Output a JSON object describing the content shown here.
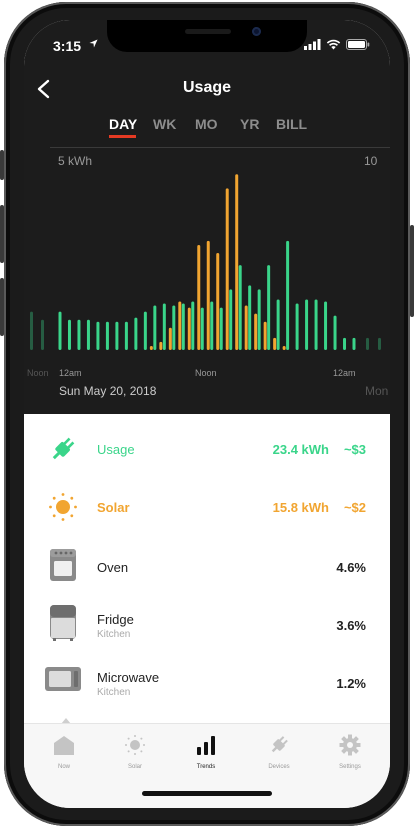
{
  "status": {
    "time": "3:15"
  },
  "header": {
    "title": "Usage"
  },
  "tabs": [
    {
      "label": "DAY",
      "active": true
    },
    {
      "label": "WK",
      "active": false
    },
    {
      "label": "MO",
      "active": false
    },
    {
      "label": "YR",
      "active": false
    },
    {
      "label": "BILL",
      "active": false
    }
  ],
  "chart_data": {
    "type": "bar",
    "y_label_left": "5 kWh",
    "y_label_right": "10",
    "x_ticks": [
      "12am",
      "Noon",
      "12am"
    ],
    "edge_ticks": [
      "Noon",
      "Mon"
    ],
    "ylim": [
      0,
      5
    ],
    "series": [
      {
        "color": "#3ad58a",
        "values": [
          0.95,
          0.75,
          0.75,
          0.75,
          0.7,
          0.7,
          0.7,
          0.7,
          0.8,
          0.95,
          1.1,
          1.15,
          1.1,
          1.15,
          1.2,
          1.05,
          1.2,
          1.05,
          1.5,
          2.1,
          1.6,
          1.5,
          2.1,
          1.25,
          2.7,
          1.15,
          1.25,
          1.25,
          1.2,
          0.85,
          0.3,
          0.3
        ]
      },
      {
        "color": "#f1a531",
        "values": [
          0,
          0,
          0,
          0,
          0,
          0,
          0,
          0,
          0,
          0.1,
          0.2,
          0.55,
          1.2,
          1.05,
          2.6,
          2.7,
          2.4,
          4.0,
          4.35,
          1.1,
          0.9,
          0.7,
          0.3,
          0.1,
          0,
          0,
          0,
          0,
          0,
          0,
          0,
          0
        ]
      }
    ]
  },
  "date_label": "Sun May 20, 2018",
  "rows": [
    {
      "name": "Usage",
      "sub": "",
      "value": "23.4 kWh",
      "cost": "~$3",
      "icon": "plug-icon",
      "color": "#3ad58a"
    },
    {
      "name": "Solar",
      "sub": "",
      "value": "15.8 kWh",
      "cost": "~$2",
      "icon": "sun-icon",
      "color": "#f1a531"
    },
    {
      "name": "Oven",
      "sub": "",
      "value": "4.6%",
      "cost": "",
      "icon": "oven-icon",
      "color": "#222"
    },
    {
      "name": "Fridge",
      "sub": "Kitchen",
      "value": "3.6%",
      "cost": "",
      "icon": "fridge-icon",
      "color": "#222"
    },
    {
      "name": "Microwave",
      "sub": "Kitchen",
      "value": "1.2%",
      "cost": "",
      "icon": "microwave-icon",
      "color": "#222"
    }
  ],
  "tabbar": [
    {
      "label": "Now",
      "icon": "house-icon",
      "active": false
    },
    {
      "label": "Solar",
      "icon": "sun-icon",
      "active": false
    },
    {
      "label": "Trends",
      "icon": "bar-chart-icon",
      "active": true
    },
    {
      "label": "Devices",
      "icon": "plug-icon",
      "active": false
    },
    {
      "label": "Settings",
      "icon": "gear-icon",
      "active": false
    }
  ]
}
